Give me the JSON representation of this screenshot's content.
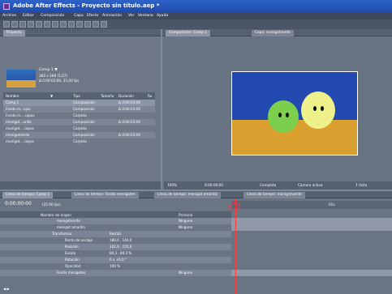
{
  "title": "Adobe After Effects - Proyecto sin título.aep *",
  "menu": [
    "Archivo",
    "Editar",
    "Composición",
    "Capa",
    "Efecto",
    "Animación",
    "Ver",
    "Ventana",
    "Ayuda"
  ],
  "project_tab": "Proyecto",
  "project_item_name": "Comp 1 ▼",
  "project_item_info1": "360 x 288 (1,07)",
  "project_item_info2": "Δ 0:00:03:00, 25,00 fps",
  "project_cols": [
    "Nombre",
    "▼",
    "Tipo",
    "Tamaño",
    "Duración",
    "Ru"
  ],
  "project_rows": [
    {
      "name": "Comp 1",
      "type": "Composición",
      "dur": "Δ 0:00:03:00"
    },
    {
      "name": "Fondo m...ojas",
      "type": "Composición",
      "dur": "Δ 0:00:03:00"
    },
    {
      "name": "Fondo m... capas",
      "type": "Carpeta",
      "dur": ""
    },
    {
      "name": "monigot...arillo",
      "type": "Composición",
      "dur": "Δ 0:00:03:00"
    },
    {
      "name": "monigot... capas",
      "type": "Carpeta",
      "dur": ""
    },
    {
      "name": "monigotverde",
      "type": "Composición",
      "dur": "Δ 0:00:03:00"
    },
    {
      "name": "monigot... capas",
      "type": "Carpeta",
      "dur": ""
    }
  ],
  "comp_tabs": [
    "Composición: Comp 1",
    "Capa: monigotverde"
  ],
  "comp_bottom": [
    "100%",
    "0:00:00:00",
    "Completa",
    "Cámara activa",
    "1 Vista"
  ],
  "timeline_tabs": [
    "Línea de tiempo: Comp 1",
    "Línea de tiempo: Fondo monigotes",
    "Línea de tiempo: monigot amarillo",
    "Línea de tiempo: monigotverde"
  ],
  "timecode": "0:00:00:00",
  "fps": "(25.00 fps)",
  "timeline_headers": [
    "Nombre de origen",
    "Primario"
  ],
  "timeline_rows": [
    {
      "name": "monigotverde",
      "extra": "Ninguno"
    },
    {
      "name": "monigot amarillo",
      "extra": "Ninguno"
    },
    {
      "name": "Transformar",
      "extra": "Restab."
    },
    {
      "name": "Punto de anclaje",
      "extra": "180,0 , 144,0"
    },
    {
      "name": "Posición",
      "extra": "101,0 , 155,0"
    },
    {
      "name": "Escala",
      "extra": "84,3 , 84,3 %"
    },
    {
      "name": "Rotación",
      "extra": "0 x +0,0 °"
    },
    {
      "name": "Opacidad",
      "extra": "100 %"
    },
    {
      "name": "Fondo monigotes",
      "extra": "Ninguno"
    }
  ],
  "ruler_label": "01s",
  "bottom_left": "◀ ▶"
}
